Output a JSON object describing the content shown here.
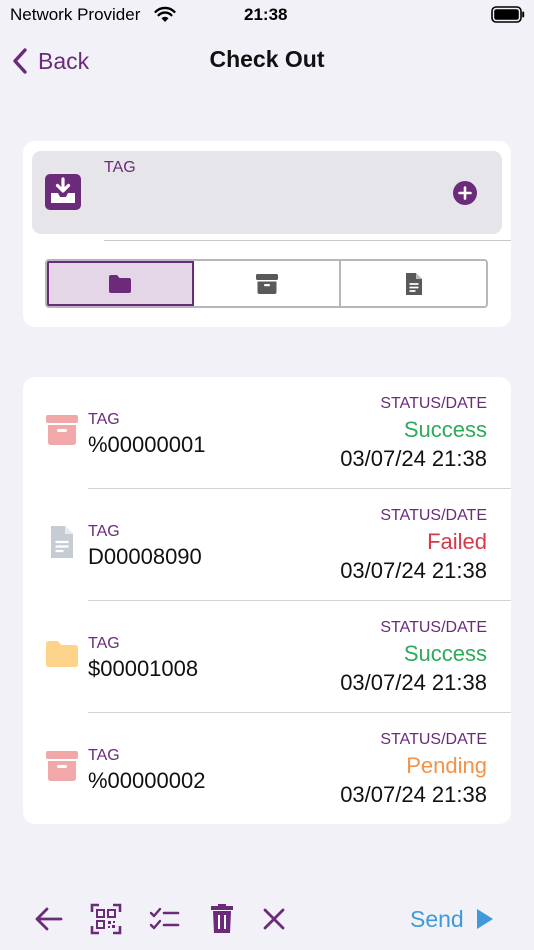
{
  "status_bar": {
    "carrier": "Network Provider",
    "time": "21:38",
    "wifi_icon": "wifi-icon",
    "battery_icon": "battery-icon"
  },
  "nav": {
    "back_label": "Back",
    "title": "Check Out"
  },
  "input": {
    "label": "TAG",
    "value": "",
    "left_icon": "inbox-download-icon",
    "add_icon": "plus-circle-icon"
  },
  "segments": [
    {
      "icon": "folder-icon",
      "selected": true
    },
    {
      "icon": "archive-box-icon",
      "selected": false
    },
    {
      "icon": "document-icon",
      "selected": false
    }
  ],
  "list": {
    "items": [
      {
        "icon": "archive-box-icon",
        "icon_color": "#f0a9a8",
        "tag_label": "TAG",
        "tag": "%00000001",
        "status_label": "STATUS/DATE",
        "status": "Success",
        "status_color": "#2eaa5c",
        "date": "03/07/24 21:38"
      },
      {
        "icon": "document-icon",
        "icon_color": "#c5ccd3",
        "tag_label": "TAG",
        "tag": "D00008090",
        "status_label": "STATUS/DATE",
        "status": "Failed",
        "status_color": "#d53a4a",
        "date": "03/07/24 21:38"
      },
      {
        "icon": "folder-icon",
        "icon_color": "#fdd38a",
        "tag_label": "TAG",
        "tag": "$00001008",
        "status_label": "STATUS/DATE",
        "status": "Success",
        "status_color": "#2eaa5c",
        "date": "03/07/24 21:38"
      },
      {
        "icon": "archive-box-icon",
        "icon_color": "#f0a9a8",
        "tag_label": "TAG",
        "tag": "%00000002",
        "status_label": "STATUS/DATE",
        "status": "Pending",
        "status_color": "#f3924a",
        "date": "03/07/24 21:38"
      }
    ]
  },
  "toolbar": {
    "tools": [
      "arrow-left-icon",
      "qr-scan-icon",
      "checklist-icon",
      "trash-icon",
      "close-icon"
    ],
    "send_label": "Send",
    "send_icon": "play-icon"
  },
  "colors": {
    "accent": "#6b2a7a",
    "send": "#3e9ad8",
    "background": "#f2f1f7"
  }
}
